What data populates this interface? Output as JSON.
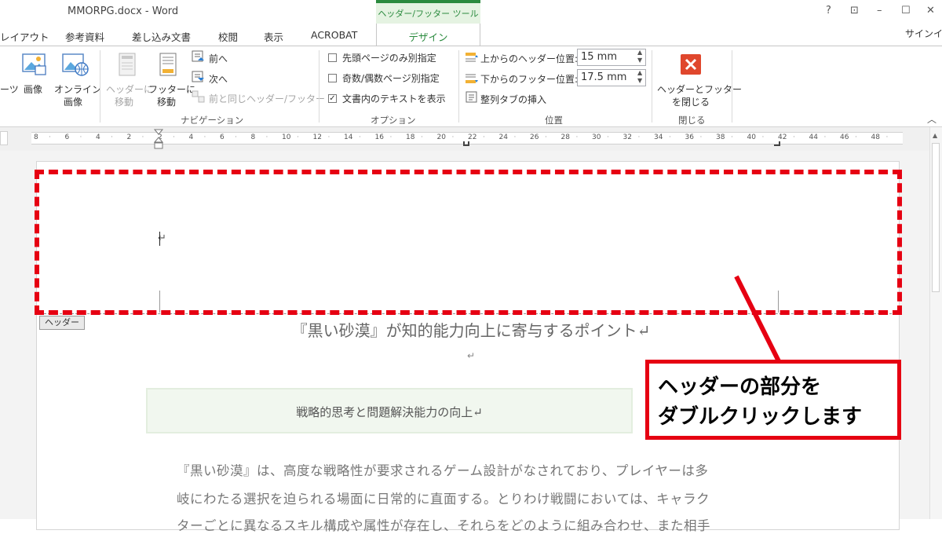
{
  "window": {
    "title": "MMORPG.docx - Word",
    "context_tool": "ヘッダー/フッター ツール",
    "help": "?",
    "restore_ribbon": "⊡",
    "minimize": "–",
    "maximize": "☐",
    "close": "✕",
    "signin": "サインイン"
  },
  "tabs": [
    "レイアウト",
    "参考資料",
    "差し込み文書",
    "校閲",
    "表示",
    "ACROBAT",
    "デザイン"
  ],
  "ribbon": {
    "insert_items": {
      "parts": "ーツ",
      "picture": "画像",
      "online_picture_1": "オンライン",
      "online_picture_2": "画像"
    },
    "navigation": {
      "goto_header_1": "ヘッダーに",
      "goto_header_2": "移動",
      "goto_footer_1": "フッターに",
      "goto_footer_2": "移動",
      "previous": "前へ",
      "next": "次へ",
      "link_previous": "前と同じヘッダー/フッター",
      "group_label": "ナビゲーション"
    },
    "options": {
      "first_page": "先頭ページのみ別指定",
      "odd_even": "奇数/偶数ページ別指定",
      "show_text": "文書内のテキストを表示",
      "show_text_checked": true,
      "group_label": "オプション"
    },
    "position": {
      "header_from_top": "上からのヘッダー位置:",
      "header_value": "15 mm",
      "footer_from_bottom": "下からのフッター位置:",
      "footer_value": "17.5 mm",
      "insert_tab": "整列タブの挿入",
      "group_label": "位置"
    },
    "close": {
      "label_1": "ヘッダーとフッター",
      "label_2": "を閉じる",
      "group_label": "閉じる"
    },
    "collapse": "︿"
  },
  "ruler": [
    "8",
    "6",
    "4",
    "2",
    "2",
    "4",
    "6",
    "8",
    "10",
    "12",
    "14",
    "16",
    "18",
    "20",
    "22",
    "24",
    "26",
    "28",
    "30",
    "32",
    "34",
    "36",
    "38",
    "40",
    "42",
    "44",
    "46",
    "48"
  ],
  "document": {
    "header_tag": "ヘッダー",
    "header_mark": "↵",
    "title": "『黒い砂漠』が知的能力向上に寄与するポイント↵",
    "empty_mark": "↵",
    "subtitle": "戦略的思考と問題解決能力の向上↵",
    "body_lines": [
      "『黒い砂漠』は、高度な戦略性が要求されるゲーム設計がなされており、プレイヤーは多",
      "岐にわたる選択を迫られる場面に日常的に直面する。とりわけ戦闘においては、キャラク",
      "ターごとに異なるスキル構成や属性が存在し、それらをどのように組み合わせ、また相手"
    ]
  },
  "callout": {
    "line1": "ヘッダーの部分を",
    "line2": "ダブルクリックします"
  },
  "colors": {
    "accent_green": "#2a8a3e",
    "annotation_red": "#e60012"
  }
}
